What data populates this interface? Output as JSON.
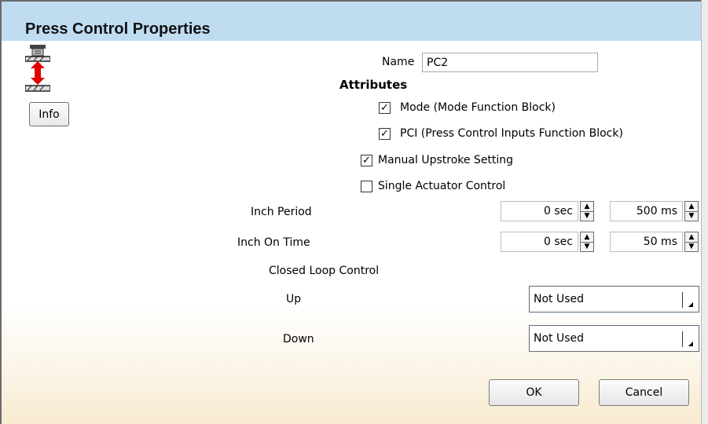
{
  "dialog": {
    "title": "Press Control Properties"
  },
  "info_button": "Info",
  "name": {
    "label": "Name",
    "value": "PC2"
  },
  "attributes": {
    "heading": "Attributes",
    "mode": {
      "label": "Mode (Mode Function Block)",
      "checked": true
    },
    "pci": {
      "label": "PCI (Press Control Inputs Function Block)",
      "checked": true
    }
  },
  "manual_upstroke": {
    "label": "Manual Upstroke Setting",
    "checked": true
  },
  "single_actuator": {
    "label": "Single Actuator Control",
    "checked": false
  },
  "inch_period": {
    "label": "Inch Period",
    "sec": "0 sec",
    "ms": "500 ms"
  },
  "inch_on_time": {
    "label": "Inch On Time",
    "sec": "0 sec",
    "ms": "50 ms"
  },
  "closed_loop": {
    "heading": "Closed Loop Control",
    "up": {
      "label": "Up",
      "value": "Not Used"
    },
    "down": {
      "label": "Down",
      "value": "Not Used"
    }
  },
  "buttons": {
    "ok": "OK",
    "cancel": "Cancel"
  },
  "icons": {
    "press": "press-control-icon",
    "check": "check-icon",
    "spin_up": "arrow-up-icon",
    "spin_down": "arrow-down-icon",
    "dropdown": "dropdown-arrow-icon"
  },
  "colors": {
    "title_bar": "#bfdcf1",
    "arrow": "#e00000"
  }
}
